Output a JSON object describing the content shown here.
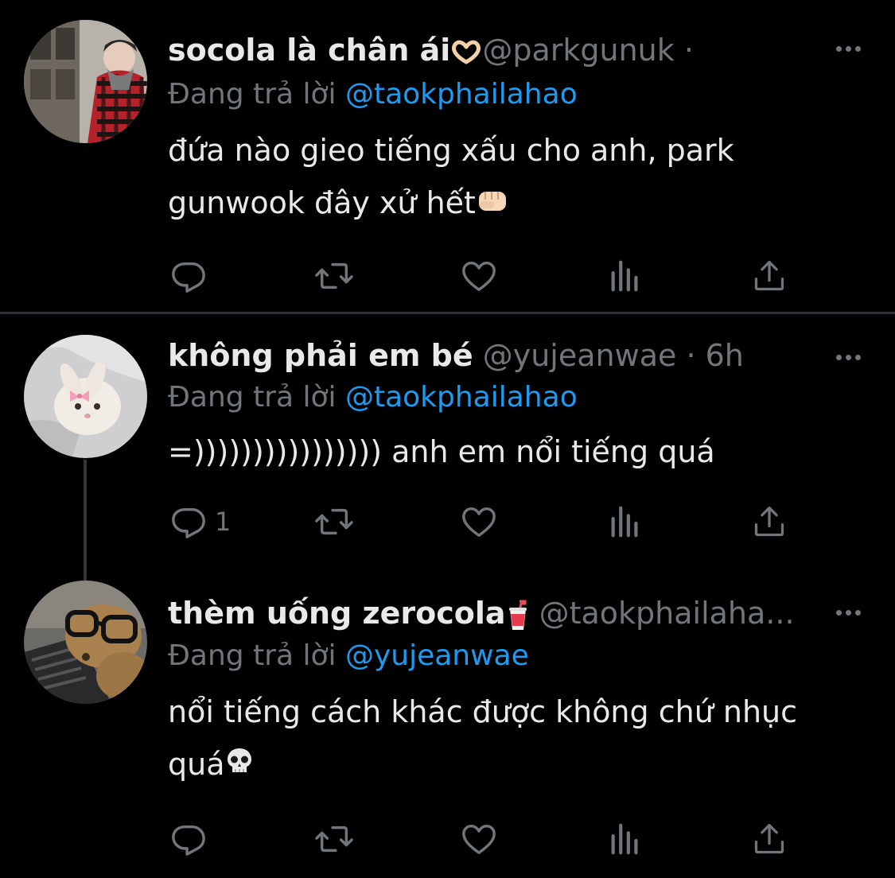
{
  "colors": {
    "background": "#000000",
    "text": "#e7e9ea",
    "muted": "#71767b",
    "link": "#1d9bf0",
    "divider": "#2f3336"
  },
  "icons": [
    "reply-icon",
    "retweet-icon",
    "like-icon",
    "views-icon",
    "share-icon",
    "more-icon"
  ],
  "tweets": [
    {
      "display_name": "socola là chân ái",
      "name_emoji": "heart-hands-emoji",
      "handle": "@parkgunuk",
      "separator": " · ",
      "time": "",
      "reply_prefix": "Đang trả lời ",
      "reply_to": "@taokphailahao",
      "text": "đứa nào gieo tiếng xấu cho anh, park\ngunwook đây xử hết",
      "text_emoji": "fist-emoji",
      "reply_count": ""
    },
    {
      "display_name": "không phải em bé",
      "handle": "@yujeanwae",
      "separator": " · ",
      "time": "6h",
      "reply_prefix": "Đang trả lời ",
      "reply_to": "@taokphailahao",
      "text": "=)))))))))))))))) anh em nổi tiếng quá",
      "reply_count": "1"
    },
    {
      "display_name": "thèm uống zerocola",
      "name_emoji": "cup-with-straw-emoji",
      "handle": "@taokphailaha...",
      "reply_prefix": "Đang trả lời ",
      "reply_to": "@yujeanwae",
      "text": "nổi tiếng cách khác được không chứ nhục\nquá",
      "text_emoji": "skull-emoji",
      "reply_count": ""
    }
  ]
}
